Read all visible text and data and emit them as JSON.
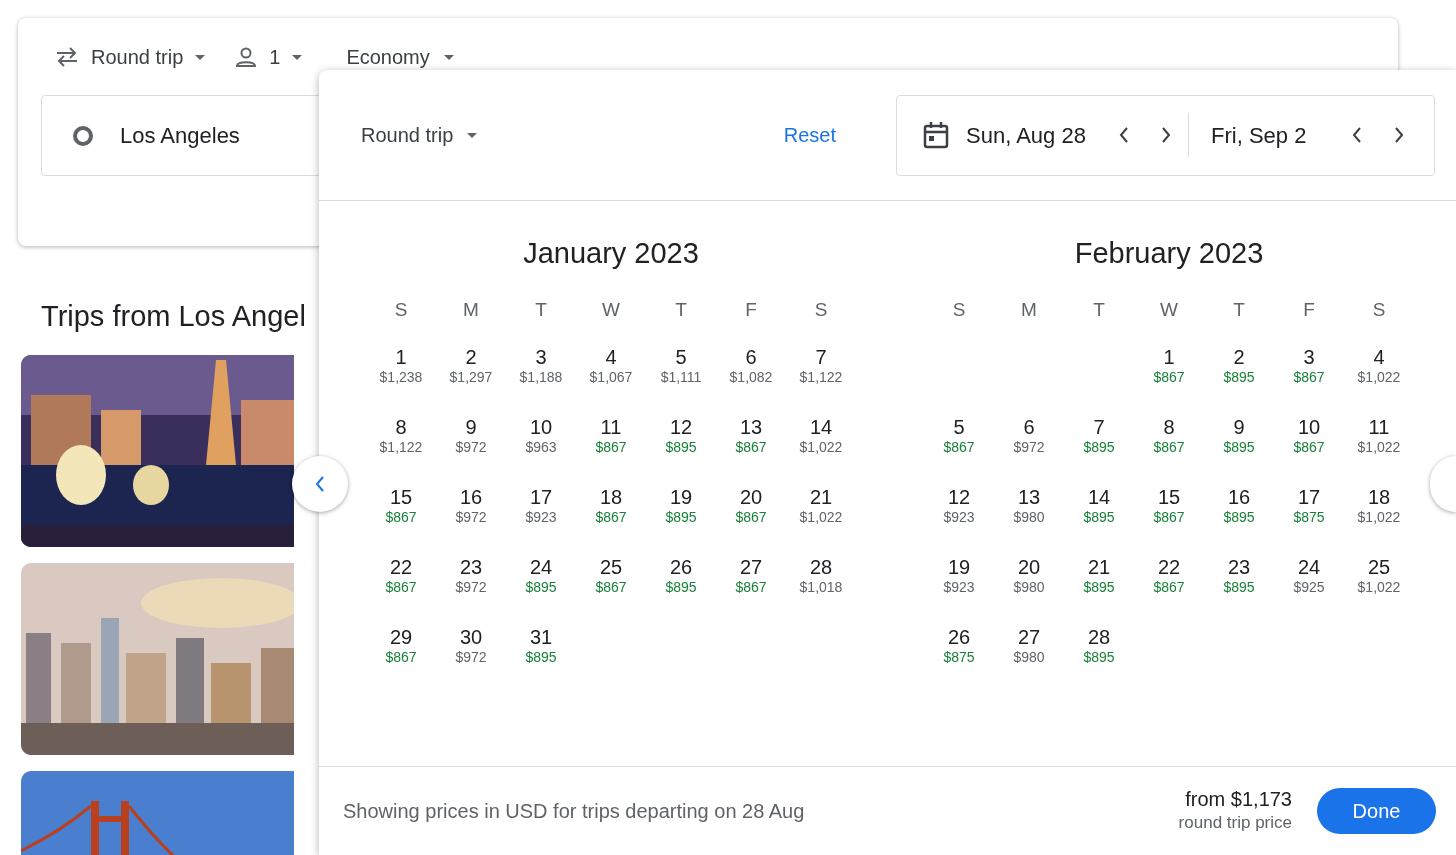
{
  "search_card": {
    "trip_type": "Round trip",
    "passengers": "1",
    "cabin": "Economy",
    "origin": "Los Angeles"
  },
  "section_title": "Trips from Los Angel",
  "date_picker": {
    "trip_type": "Round trip",
    "reset": "Reset",
    "departure": "Sun, Aug 28",
    "return": "Fri, Sep 2",
    "months": [
      {
        "title": "January 2023",
        "weekdays": [
          "S",
          "M",
          "T",
          "W",
          "T",
          "F",
          "S"
        ],
        "weeks": [
          {
            "kind": "left",
            "days": [
              {
                "d": "1",
                "p": "$1,238",
                "low": false
              },
              {
                "d": "2",
                "p": "$1,297",
                "low": false
              },
              {
                "d": "3",
                "p": "$1,188",
                "low": false
              },
              {
                "d": "4",
                "p": "$1,067",
                "low": false
              },
              {
                "d": "5",
                "p": "$1,111",
                "low": false
              },
              {
                "d": "6",
                "p": "$1,082",
                "low": false
              },
              {
                "d": "7",
                "p": "$1,122",
                "low": false
              }
            ]
          },
          {
            "kind": "left",
            "days": [
              {
                "d": "8",
                "p": "$1,122",
                "low": false
              },
              {
                "d": "9",
                "p": "$972",
                "low": false
              },
              {
                "d": "10",
                "p": "$963",
                "low": false
              },
              {
                "d": "11",
                "p": "$867",
                "low": true
              },
              {
                "d": "12",
                "p": "$895",
                "low": true
              },
              {
                "d": "13",
                "p": "$867",
                "low": true
              },
              {
                "d": "14",
                "p": "$1,022",
                "low": false
              }
            ]
          },
          {
            "kind": "left",
            "days": [
              {
                "d": "15",
                "p": "$867",
                "low": true
              },
              {
                "d": "16",
                "p": "$972",
                "low": false
              },
              {
                "d": "17",
                "p": "$923",
                "low": false
              },
              {
                "d": "18",
                "p": "$867",
                "low": true
              },
              {
                "d": "19",
                "p": "$895",
                "low": true
              },
              {
                "d": "20",
                "p": "$867",
                "low": true
              },
              {
                "d": "21",
                "p": "$1,022",
                "low": false
              }
            ]
          },
          {
            "kind": "left",
            "days": [
              {
                "d": "22",
                "p": "$867",
                "low": true
              },
              {
                "d": "23",
                "p": "$972",
                "low": false
              },
              {
                "d": "24",
                "p": "$895",
                "low": true
              },
              {
                "d": "25",
                "p": "$867",
                "low": true
              },
              {
                "d": "26",
                "p": "$895",
                "low": true
              },
              {
                "d": "27",
                "p": "$867",
                "low": true
              },
              {
                "d": "28",
                "p": "$1,018",
                "low": false
              }
            ]
          },
          {
            "kind": "left",
            "days": [
              {
                "d": "29",
                "p": "$867",
                "low": true
              },
              {
                "d": "30",
                "p": "$972",
                "low": false
              },
              {
                "d": "31",
                "p": "$895",
                "low": true
              }
            ]
          }
        ]
      },
      {
        "title": "February 2023",
        "weekdays": [
          "S",
          "M",
          "T",
          "W",
          "T",
          "F",
          "S"
        ],
        "weeks": [
          {
            "kind": "right",
            "days": [
              {
                "d": "1",
                "p": "$867",
                "low": true
              },
              {
                "d": "2",
                "p": "$895",
                "low": true
              },
              {
                "d": "3",
                "p": "$867",
                "low": true
              },
              {
                "d": "4",
                "p": "$1,022",
                "low": false
              }
            ]
          },
          {
            "kind": "left",
            "days": [
              {
                "d": "5",
                "p": "$867",
                "low": true
              },
              {
                "d": "6",
                "p": "$972",
                "low": false
              },
              {
                "d": "7",
                "p": "$895",
                "low": true
              },
              {
                "d": "8",
                "p": "$867",
                "low": true
              },
              {
                "d": "9",
                "p": "$895",
                "low": true
              },
              {
                "d": "10",
                "p": "$867",
                "low": true
              },
              {
                "d": "11",
                "p": "$1,022",
                "low": false
              }
            ]
          },
          {
            "kind": "left",
            "days": [
              {
                "d": "12",
                "p": "$923",
                "low": false
              },
              {
                "d": "13",
                "p": "$980",
                "low": false
              },
              {
                "d": "14",
                "p": "$895",
                "low": true
              },
              {
                "d": "15",
                "p": "$867",
                "low": true
              },
              {
                "d": "16",
                "p": "$895",
                "low": true
              },
              {
                "d": "17",
                "p": "$875",
                "low": true
              },
              {
                "d": "18",
                "p": "$1,022",
                "low": false
              }
            ]
          },
          {
            "kind": "left",
            "days": [
              {
                "d": "19",
                "p": "$923",
                "low": false
              },
              {
                "d": "20",
                "p": "$980",
                "low": false
              },
              {
                "d": "21",
                "p": "$895",
                "low": true
              },
              {
                "d": "22",
                "p": "$867",
                "low": true
              },
              {
                "d": "23",
                "p": "$895",
                "low": true
              },
              {
                "d": "24",
                "p": "$925",
                "low": false
              },
              {
                "d": "25",
                "p": "$1,022",
                "low": false
              }
            ]
          },
          {
            "kind": "left",
            "days": [
              {
                "d": "26",
                "p": "$875",
                "low": true
              },
              {
                "d": "27",
                "p": "$980",
                "low": false
              },
              {
                "d": "28",
                "p": "$895",
                "low": true
              }
            ]
          }
        ]
      }
    ],
    "footer_note": "Showing prices in USD for trips departing on 28 Aug",
    "total_price": "from $1,173",
    "total_caption": "round trip price",
    "done": "Done"
  }
}
